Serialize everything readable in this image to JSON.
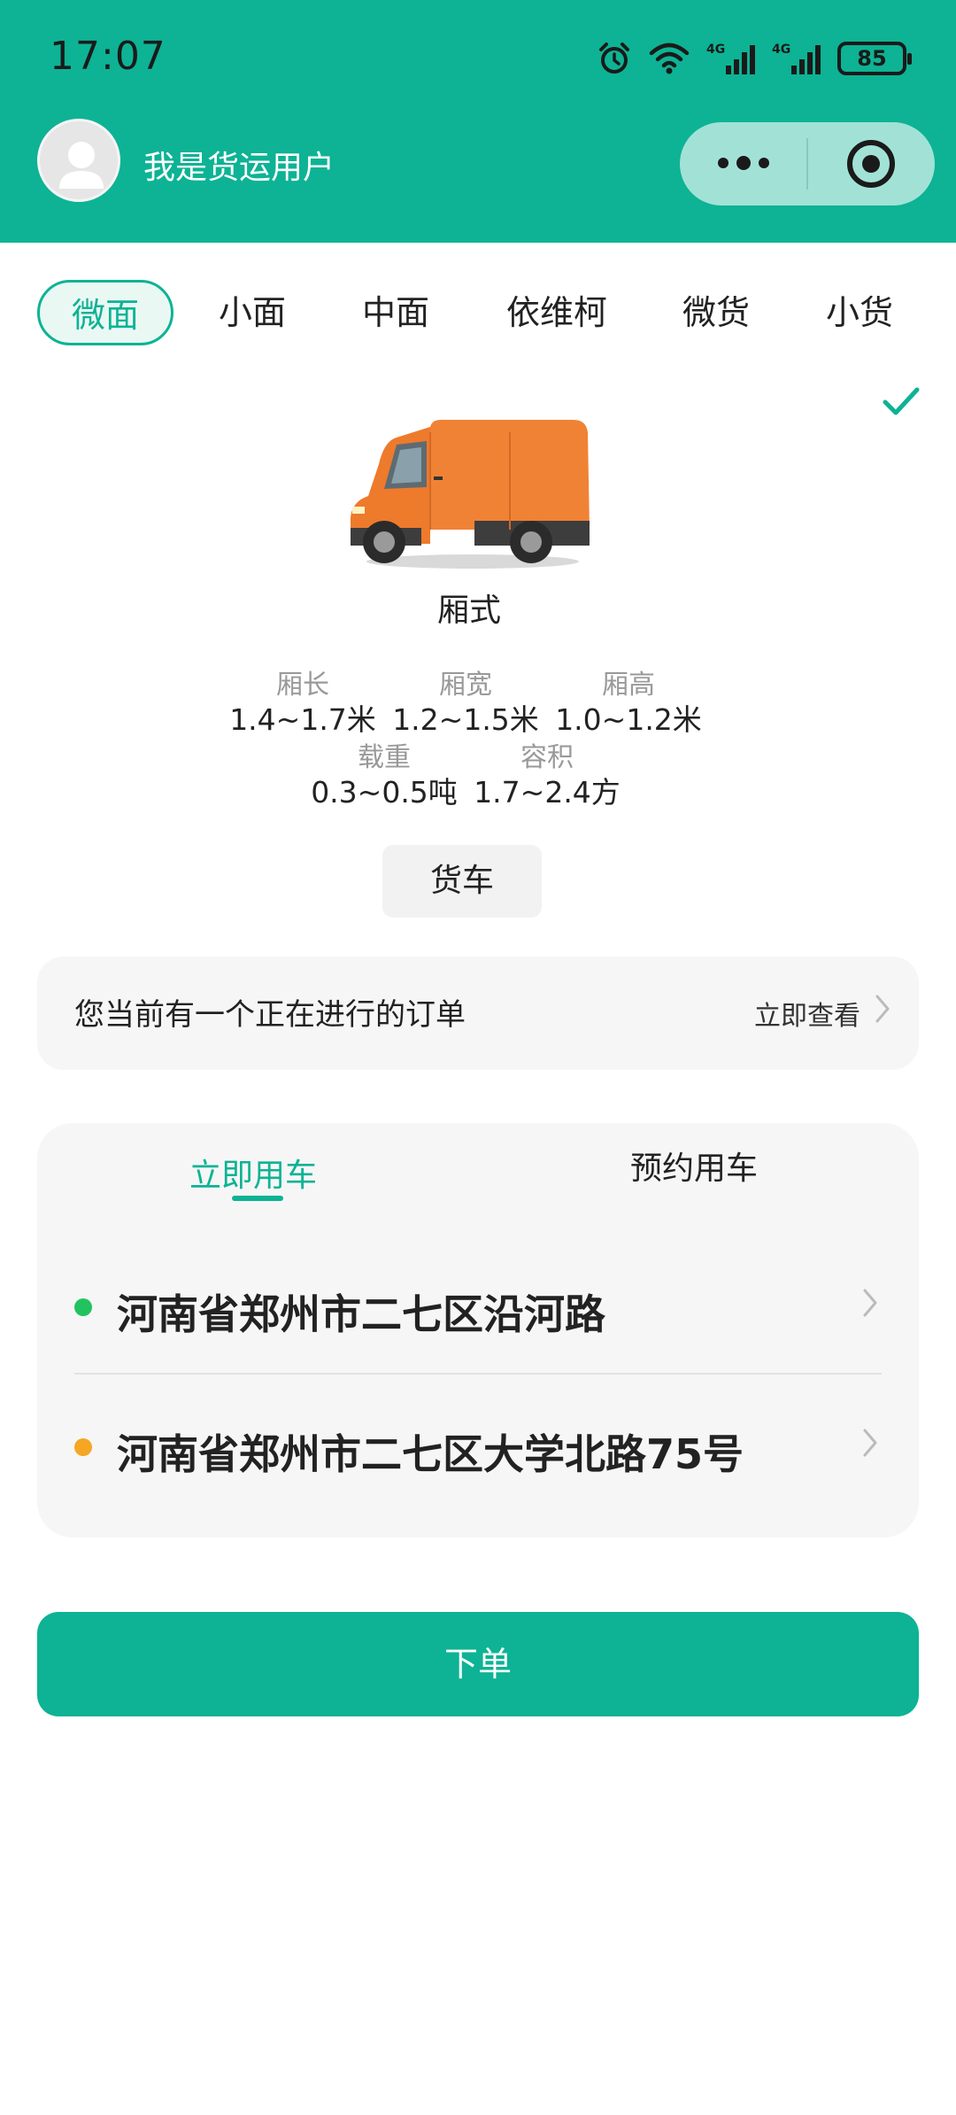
{
  "status_bar": {
    "time": "17:07",
    "battery": "85"
  },
  "header": {
    "user_name": "我是货运用户"
  },
  "vehicle_tabs": [
    "微面",
    "小面",
    "中面",
    "依维柯",
    "微货",
    "小货"
  ],
  "vehicle": {
    "type": "厢式",
    "specs": [
      {
        "label": "厢长",
        "value": "1.4~1.7米"
      },
      {
        "label": "厢宽",
        "value": "1.2~1.5米"
      },
      {
        "label": "厢高",
        "value": "1.0~1.2米"
      },
      {
        "label": "载重",
        "value": "0.3~0.5吨"
      },
      {
        "label": "容积",
        "value": "1.7~2.4方"
      }
    ],
    "category_button": "货车"
  },
  "order_notice": {
    "text": "您当前有一个正在进行的订单",
    "link": "立即查看"
  },
  "trip": {
    "tabs": [
      "立即用车",
      "预约用车"
    ],
    "pickup": "河南省郑州市二七区沿河路",
    "dropoff": "河南省郑州市二七区大学北路75号"
  },
  "submit_label": "下单",
  "colors": {
    "brand": "#0db394",
    "pickup_dot": "#22c35e",
    "dropoff_dot": "#f5a623"
  }
}
